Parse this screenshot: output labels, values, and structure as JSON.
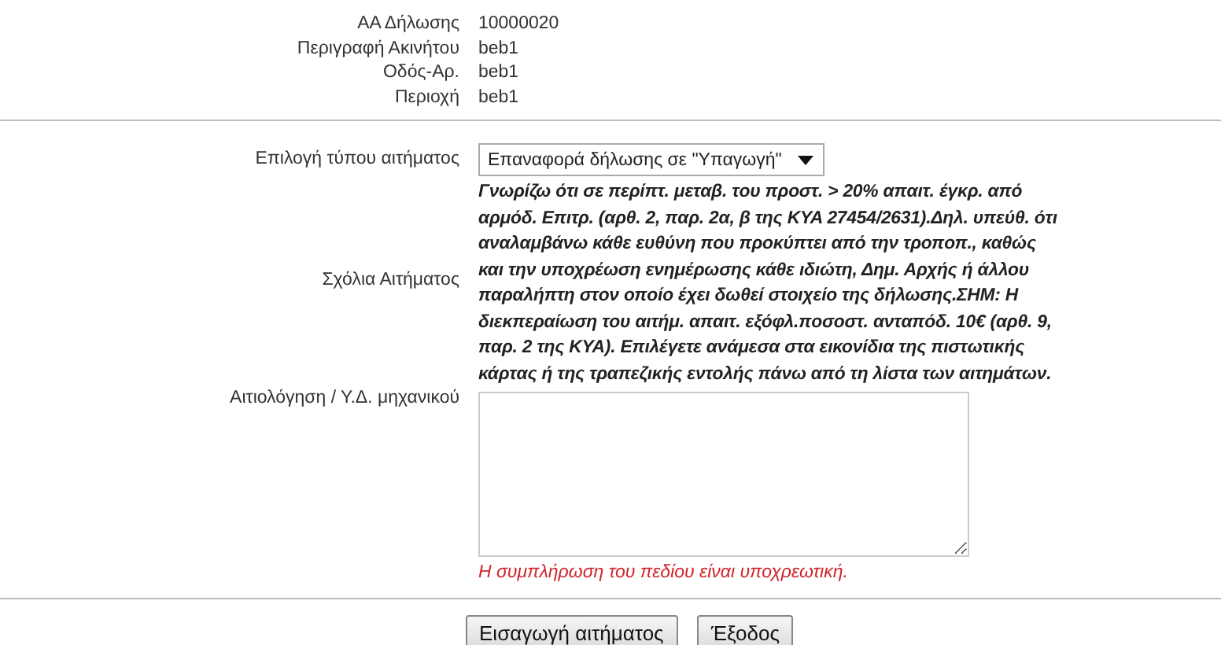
{
  "info_rows": [
    {
      "label": "ΑΑ Δήλωσης",
      "value": "10000020"
    },
    {
      "label": "Περιγραφή Ακινήτου",
      "value": "beb1"
    },
    {
      "label": "Οδός-Αρ.",
      "value": "beb1"
    },
    {
      "label": "Περιοχή",
      "value": "beb1"
    }
  ],
  "request_type": {
    "label": "Επιλογή τύπου αιτήματος",
    "value": "Επαναφορά δήλωσης σε \"Υπαγωγή\""
  },
  "comments": {
    "label": "Σχόλια Αιτήματος",
    "text": "Γνωρίζω ότι σε περίπτ. μεταβ. του προστ. > 20% απαιτ. έγκρ. από αρμόδ. Επιτρ. (αρθ. 2, παρ. 2α, β της ΚΥΑ 27454/2631).Δηλ. υπεύθ. ότι αναλαμβάνω κάθε ευθύνη που προκύπτει από την τροποπ., καθώς και την υποχρέωση ενημέρωσης κάθε ιδιώτη, Δημ. Αρχής ή άλλου παραλήπτη στον οποίο έχει δωθεί στοιχείο της δήλωσης.ΣΗΜ: Η διεκπεραίωση του αιτήμ. απαιτ. εξόφλ.ποσοστ. ανταπόδ. 10€ (αρθ. 9, παρ. 2 της ΚΥΑ). Επιλέγετε ανάμεσα στα εικονίδια της πιστωτικής κάρτας ή της τραπεζικής εντολής πάνω από τη λίστα των αιτημάτων."
  },
  "justification": {
    "label": "Αιτιολόγηση / Υ.Δ. μηχανικού",
    "error": "Η συμπλήρωση του πεδίου είναι υποχρεωτική."
  },
  "buttons": [
    "Εισαγωγή αιτήματος",
    "Έξοδος"
  ]
}
